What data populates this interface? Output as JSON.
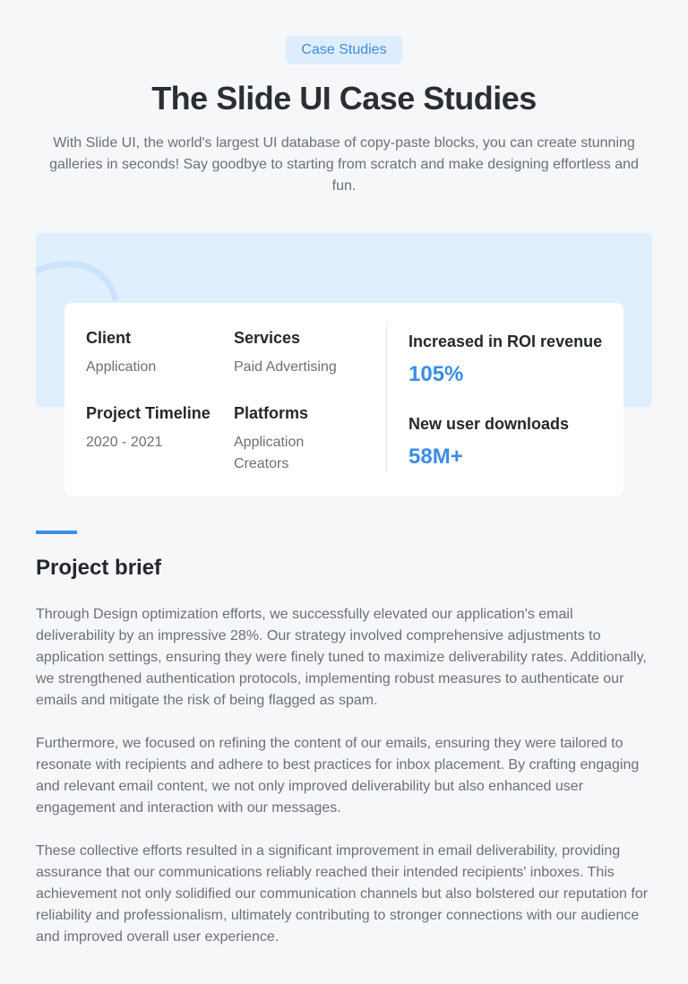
{
  "header": {
    "badge": "Case Studies",
    "title": "The Slide UI Case Studies",
    "subtitle": "With Slide UI, the world's largest UI database of copy-paste blocks, you can create stunning galleries in seconds! Say goodbye to starting from scratch and make designing effortless and fun."
  },
  "details": {
    "client": {
      "label": "Client",
      "value": "Application"
    },
    "services": {
      "label": "Services",
      "value": "Paid Advertising"
    },
    "timeline": {
      "label": "Project Timeline",
      "value": "2020 - 2021"
    },
    "platforms": {
      "label": "Platforms",
      "value": "Application Creators"
    }
  },
  "stats": {
    "roi": {
      "label": "Increased in ROI revenue",
      "value": "105%"
    },
    "downloads": {
      "label": "New user downloads",
      "value": "58M+"
    }
  },
  "brief": {
    "title": "Project brief",
    "paragraphs": [
      "Through Design optimization efforts, we successfully elevated our application's email deliverability by an impressive 28%. Our strategy involved comprehensive adjustments to application settings, ensuring they were finely tuned to maximize deliverability rates. Additionally, we strengthened authentication protocols, implementing robust measures to authenticate our emails and mitigate the risk of being flagged as spam.",
      "Furthermore, we focused on refining the content of our emails, ensuring they were tailored to resonate with recipients and adhere to best practices for inbox placement. By crafting engaging and relevant email content, we not only improved deliverability but also enhanced user engagement and interaction with our messages.",
      "These collective efforts resulted in a significant improvement in email deliverability, providing assurance that our communications reliably reached their intended recipients' inboxes. This achievement not only solidified our communication channels but also bolstered our reputation for reliability and professionalism, ultimately contributing to stronger connections with our audience and improved overall user experience."
    ]
  },
  "colors": {
    "accent": "#3c8de4",
    "badge_bg": "#dfeefe",
    "hero_bg": "#e0effe",
    "page_bg": "#f6f7f9"
  }
}
